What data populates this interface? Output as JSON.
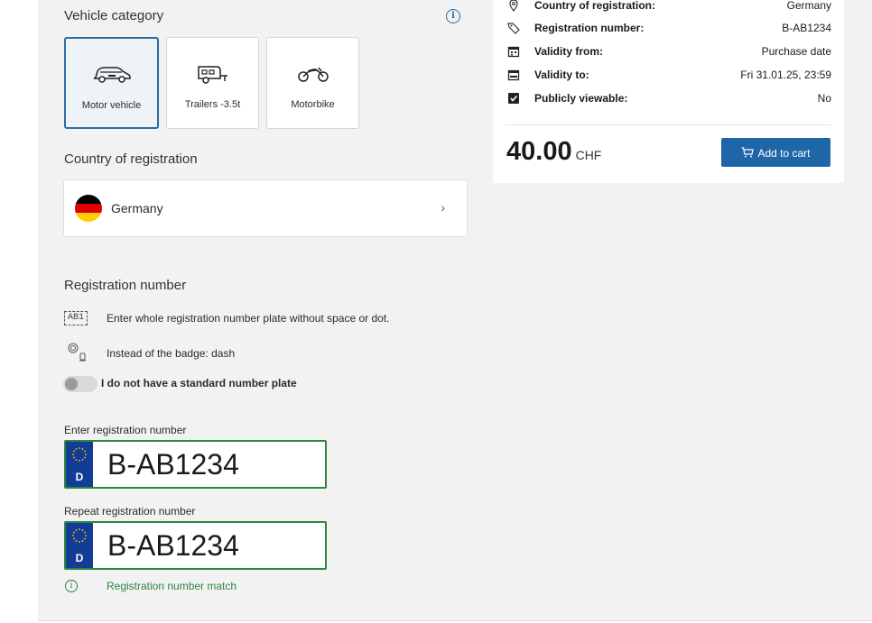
{
  "vehicle_category": {
    "label": "Vehicle category",
    "options": [
      {
        "label": "Motor vehicle",
        "icon": "car-icon",
        "selected": true
      },
      {
        "label": "Trailers -3.5t",
        "icon": "trailer-icon",
        "selected": false
      },
      {
        "label": "Motorbike",
        "icon": "motorbike-icon",
        "selected": false
      }
    ]
  },
  "country": {
    "label": "Country of registration",
    "selected": "Germany",
    "flag_colors": [
      "#000000",
      "#dd0000",
      "#ffce00"
    ]
  },
  "registration": {
    "title": "Registration number",
    "plate_hint_icon_text": "AB1",
    "hint_plate": "Enter whole registration number plate without space or dot.",
    "hint_badge": "Instead of the badge: dash",
    "toggle_label": "I do not have a standard number plate",
    "toggle_on": false,
    "enter_label": "Enter registration number",
    "enter_value": "B-AB1234",
    "repeat_label": "Repeat registration number",
    "repeat_value": "B-AB1234",
    "country_code": "D",
    "match_message": "Registration number match"
  },
  "summary": {
    "rows": [
      {
        "key": "Country of registration:",
        "value": "Germany",
        "icon": "location-pin-icon"
      },
      {
        "key": "Registration number:",
        "value": "B-AB1234",
        "icon": "tag-icon"
      },
      {
        "key": "Validity from:",
        "value": "Purchase date",
        "icon": "calendar-start-icon"
      },
      {
        "key": "Validity to:",
        "value": "Fri 31.01.25, 23:59",
        "icon": "calendar-end-icon"
      },
      {
        "key": "Publicly viewable:",
        "value": "No",
        "icon": "checkbox-icon"
      }
    ],
    "price": "40.00",
    "currency": "CHF",
    "add_to_cart": "Add to cart"
  },
  "colors": {
    "accent": "#1e66a8",
    "selected_border": "#2d6da3",
    "success": "#2e8540",
    "eu_blue": "#123c96",
    "panel_bg": "#f2f2f2"
  }
}
